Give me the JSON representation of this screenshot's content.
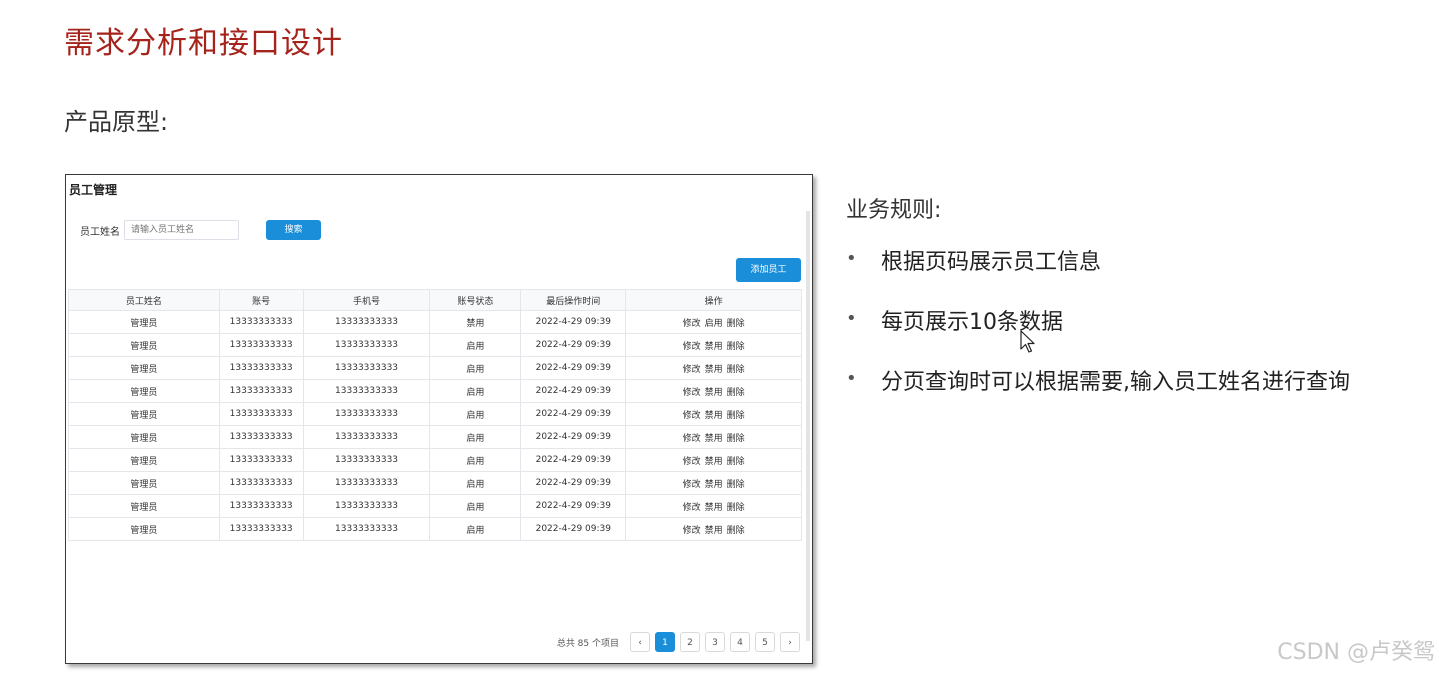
{
  "slide": {
    "title": "需求分析和接口设计",
    "subtitle": "产品原型:"
  },
  "prototype": {
    "page_title": "员工管理",
    "search": {
      "label": "员工姓名",
      "placeholder": "请输入员工姓名",
      "button_label": "搜索"
    },
    "add_button_label": "添加员工",
    "table": {
      "columns": [
        "员工姓名",
        "账号",
        "手机号",
        "账号状态",
        "最后操作时间",
        "操作"
      ],
      "actions": {
        "edit": "修改",
        "disable": "禁用",
        "enable": "启用",
        "delete": "删除"
      },
      "rows": [
        {
          "name": "管理员",
          "account": "13333333333",
          "phone": "13333333333",
          "status": "禁用",
          "time": "2022-4-29 09:39",
          "toggle": "启用"
        },
        {
          "name": "管理员",
          "account": "13333333333",
          "phone": "13333333333",
          "status": "启用",
          "time": "2022-4-29 09:39",
          "toggle": "禁用"
        },
        {
          "name": "管理员",
          "account": "13333333333",
          "phone": "13333333333",
          "status": "启用",
          "time": "2022-4-29 09:39",
          "toggle": "禁用"
        },
        {
          "name": "管理员",
          "account": "13333333333",
          "phone": "13333333333",
          "status": "启用",
          "time": "2022-4-29 09:39",
          "toggle": "禁用"
        },
        {
          "name": "管理员",
          "account": "13333333333",
          "phone": "13333333333",
          "status": "启用",
          "time": "2022-4-29 09:39",
          "toggle": "禁用"
        },
        {
          "name": "管理员",
          "account": "13333333333",
          "phone": "13333333333",
          "status": "启用",
          "time": "2022-4-29 09:39",
          "toggle": "禁用"
        },
        {
          "name": "管理员",
          "account": "13333333333",
          "phone": "13333333333",
          "status": "启用",
          "time": "2022-4-29 09:39",
          "toggle": "禁用"
        },
        {
          "name": "管理员",
          "account": "13333333333",
          "phone": "13333333333",
          "status": "启用",
          "time": "2022-4-29 09:39",
          "toggle": "禁用"
        },
        {
          "name": "管理员",
          "account": "13333333333",
          "phone": "13333333333",
          "status": "启用",
          "time": "2022-4-29 09:39",
          "toggle": "禁用"
        },
        {
          "name": "管理员",
          "account": "13333333333",
          "phone": "13333333333",
          "status": "启用",
          "time": "2022-4-29 09:39",
          "toggle": "禁用"
        }
      ]
    },
    "pagination": {
      "total_text": "总共 85 个项目",
      "prev_icon": "chevron-left-icon",
      "next_icon": "chevron-right-icon",
      "pages": [
        "1",
        "2",
        "3",
        "4",
        "5"
      ],
      "current_page": "1"
    }
  },
  "rules": {
    "title": "业务规则:",
    "items": [
      "根据页码展示员工信息",
      "每页展示10条数据",
      "分页查询时可以根据需要,输入员工姓名进行查询"
    ]
  },
  "watermark": "CSDN @卢癸鸳",
  "colors": {
    "title_red": "#a5231b",
    "primary_blue": "#1a8ed8"
  }
}
